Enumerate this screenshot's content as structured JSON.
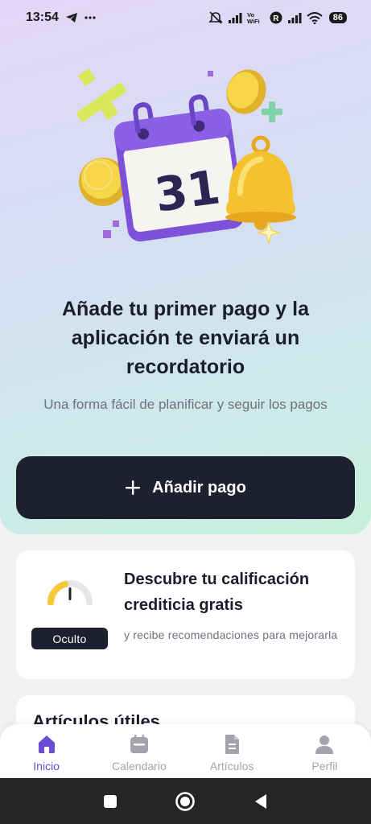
{
  "status_bar": {
    "time": "13:54",
    "battery": "86"
  },
  "hero": {
    "calendar_day": "31",
    "headline": "Añade tu primer pago y la aplicación te enviará un recordatorio",
    "subline": "Una forma fácil de planificar y seguir los pagos",
    "add_button_label": "Añadir pago"
  },
  "credit_card": {
    "badge": "Oculto",
    "title": "Descubre tu calificación crediticia gratis",
    "subtitle": "y recibe recomendaciones para mejorarla"
  },
  "articles": {
    "title": "Artículos útiles"
  },
  "bottom_nav": {
    "items": [
      {
        "label": "Inicio",
        "icon": "home-icon",
        "active": true
      },
      {
        "label": "Calendario",
        "icon": "calendar-icon",
        "active": false
      },
      {
        "label": "Artículos",
        "icon": "document-icon",
        "active": false
      },
      {
        "label": "Perfil",
        "icon": "person-icon",
        "active": false
      }
    ]
  },
  "colors": {
    "accent": "#6a4bd3",
    "dark_button": "#1e2030",
    "gauge_yellow": "#f5c937"
  }
}
